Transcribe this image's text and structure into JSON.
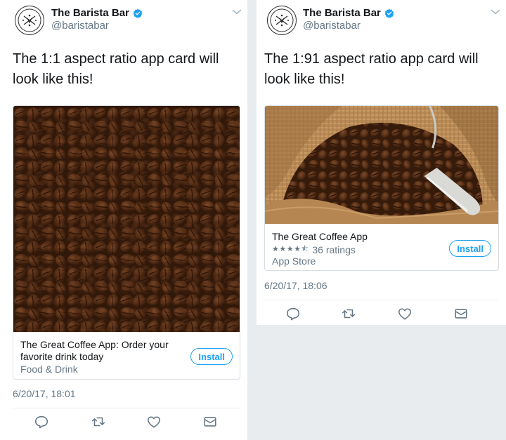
{
  "tweets": [
    {
      "account": {
        "name": "The Barista Bar",
        "handle": "@baristabar",
        "avatar_icon": "coffee-logo-icon"
      },
      "text": "The 1:1 aspect ratio app card will look like this!",
      "card": {
        "title": "The Great Coffee App: Order your favorite drink today",
        "subtitle": "Food & Drink",
        "install_label": "Install",
        "image": "coffee-beans-square"
      },
      "timestamp": "6/20/17, 18:01",
      "actions": [
        "reply-icon",
        "retweet-icon",
        "like-icon",
        "message-icon"
      ]
    },
    {
      "account": {
        "name": "The Barista Bar",
        "handle": "@baristabar",
        "avatar_icon": "coffee-logo-icon"
      },
      "text": "The 1:91 aspect ratio app card will look like this!",
      "card": {
        "title": "The Great Coffee App",
        "stars": "★★★★⯪",
        "ratings": "36 ratings",
        "store": "App Store",
        "install_label": "Install",
        "image": "coffee-beans-sack-scoop"
      },
      "timestamp": "6/20/17, 18:06",
      "actions": [
        "reply-icon",
        "retweet-icon",
        "like-icon",
        "message-icon"
      ]
    }
  ],
  "colors": {
    "accent": "#1da1f2",
    "text": "#14171a",
    "secondary": "#657786",
    "divider": "#e6ecf0",
    "background": "#e9ecef"
  }
}
